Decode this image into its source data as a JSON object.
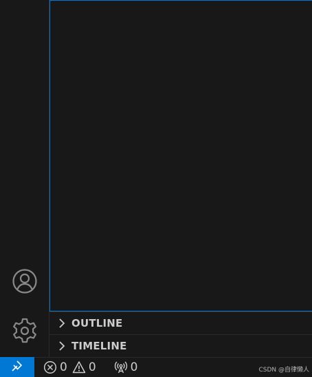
{
  "activity_bar": {
    "account_icon": "account-icon",
    "manage_icon": "gear-icon"
  },
  "panels": {
    "outline": {
      "label": "OUTLINE",
      "icon": "chevron-right-icon"
    },
    "timeline": {
      "label": "TIMELINE",
      "icon": "chevron-right-icon"
    }
  },
  "status_bar": {
    "remote_icon": "remote-icon",
    "errors": "0",
    "warnings": "0",
    "ports": "0",
    "watermark": "CSDN @自律懒人"
  },
  "colors": {
    "accent": "#0078d4",
    "background": "#181818",
    "foreground": "#cccccc"
  }
}
